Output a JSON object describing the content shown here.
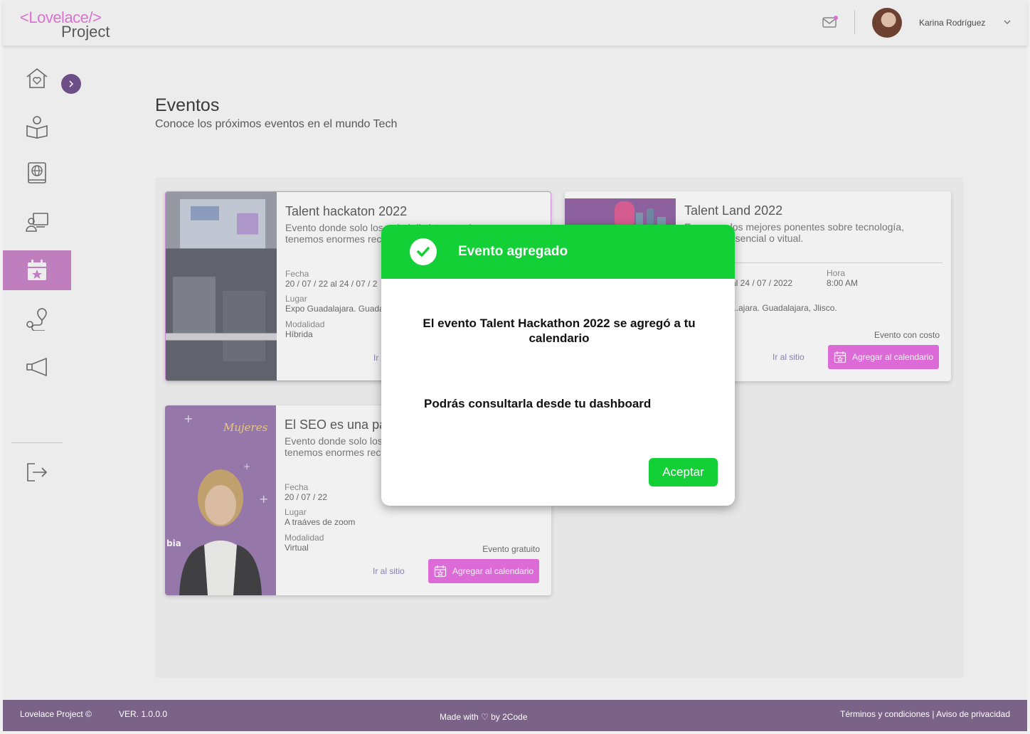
{
  "header": {
    "logo_line1": "<Lovelace/>",
    "logo_line2": "Project",
    "user_name": "Karina Rodríguez"
  },
  "page": {
    "title": "Eventos",
    "subtitle": "Conoce los próximos eventos en el mundo Tech"
  },
  "cards": [
    {
      "title": "Talent hackaton 2022",
      "description": "Evento donde solo los ... lod distintos tracks y p... tenemos enormes rec...",
      "fecha_label": "Fecha",
      "fecha": "20 / 07 / 22  al  24 / 07 / 2",
      "lugar_label": "Lugar",
      "lugar": "Expo Guadalajara. Guadal",
      "modalidad_label": "Modalidad",
      "modalidad": "Híbrida",
      "site_link": "Ir a"
    },
    {
      "title": "Talent Land 2022",
      "description": "E... reune los mejores ponentes sobre tecnología, ...anera presencial o vitual.",
      "fecha": "al  24 / 07 / 2022",
      "hora_label": "Hora",
      "hora": "8:00 AM",
      "lugar": "...ajara. Guadalajara, Jlisco.",
      "cost": "Evento con costo",
      "site_link": "Ir al sitio",
      "add_label": "Agregar al calendario"
    },
    {
      "title": "El SEO es una pas",
      "description": "Evento donde solo los ... lod distintos tracks y p... tenemos enormes rec...",
      "fecha_label": "Fecha",
      "fecha": "20 / 07 / 22",
      "lugar_label": "Lugar",
      "lugar": "A traáves de zoom",
      "modalidad_label": "Modalidad",
      "modalidad": "Virtual",
      "cost": "Evento gratuito",
      "site_link": "Ir al sitio",
      "add_label": "Agregar al calendario",
      "image_text": "bia"
    }
  ],
  "modal": {
    "title": "Evento agregado",
    "message": "El evento Talent Hackathon 2022 se agregó a tu calendario",
    "message2": "Podrás consultarla desde tu dashboard",
    "accept": "Aceptar"
  },
  "footer": {
    "copyright": "Lovelace Project ©",
    "version": "VER. 1.0.0.0",
    "made_with": "Made with ♡ by 2Code",
    "links": "Términos y condiciones | Aviso de privacidad"
  },
  "colors": {
    "accent": "#e86ae4",
    "success": "#12d036",
    "footer": "#7b6287",
    "sidebar_active": "#c880c8"
  }
}
